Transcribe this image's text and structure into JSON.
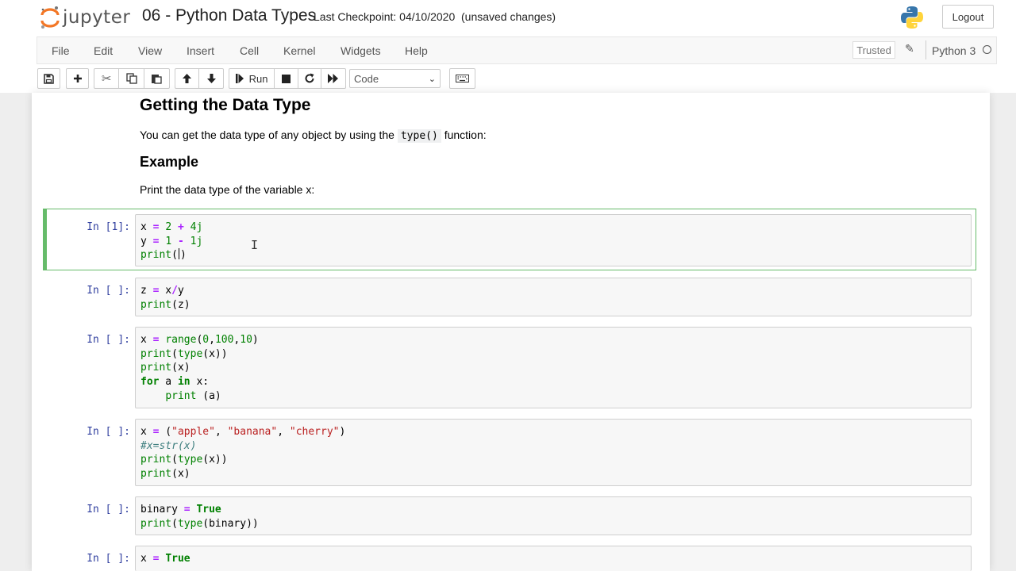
{
  "header": {
    "logo_text": "jupyter",
    "notebook_title": "06 - Python Data Types",
    "checkpoint": "Last Checkpoint: 04/10/2020",
    "unsaved": "(unsaved changes)",
    "logout_label": "Logout"
  },
  "menubar": {
    "items": [
      "File",
      "Edit",
      "View",
      "Insert",
      "Cell",
      "Kernel",
      "Widgets",
      "Help"
    ],
    "trusted_label": "Trusted",
    "kernel_name": "Python 3"
  },
  "toolbar": {
    "run_label": "Run",
    "cell_type": "Code"
  },
  "markdown": {
    "heading": "Getting the Data Type",
    "intro_before": "You can get the data type of any object by using the",
    "intro_code": "type()",
    "intro_after": "function:",
    "example_heading": "Example",
    "example_text": "Print the data type of the variable x:"
  },
  "cells": [
    {
      "prompt": "In [1]:",
      "lines": [
        "x = 2 + 4j",
        "y = 1 - 1j",
        "print()"
      ]
    },
    {
      "prompt": "In [ ]:",
      "lines": [
        "z = x/y",
        "print(z)"
      ]
    },
    {
      "prompt": "In [ ]:",
      "lines": [
        "x = range(0,100,10)",
        "print(type(x))",
        "print(x)",
        "for a in x:",
        "    print (a)"
      ]
    },
    {
      "prompt": "In [ ]:",
      "lines": [
        "x = (\"apple\", \"banana\", \"cherry\")",
        "#x=str(x)",
        "print(type(x))",
        "print(x)"
      ]
    },
    {
      "prompt": "In [ ]:",
      "lines": [
        "binary = True",
        "print(type(binary))"
      ]
    },
    {
      "prompt": "In [ ]:",
      "lines": [
        "x = True"
      ]
    }
  ],
  "colors": {
    "selected_border": "#66bb6a",
    "prompt": "#303f9f",
    "keyword": "#008000",
    "operator": "#aa22ff",
    "string": "#ba2121",
    "comment": "#408080"
  },
  "icons": [
    "jupyter-logo-icon",
    "python-logo-icon",
    "save-icon",
    "plus-icon",
    "cut-icon",
    "copy-icon",
    "paste-icon",
    "arrow-up-icon",
    "arrow-down-icon",
    "step-forward-icon",
    "stop-icon",
    "refresh-icon",
    "fast-forward-icon",
    "keyboard-icon",
    "pencil-icon",
    "kernel-status-icon"
  ]
}
